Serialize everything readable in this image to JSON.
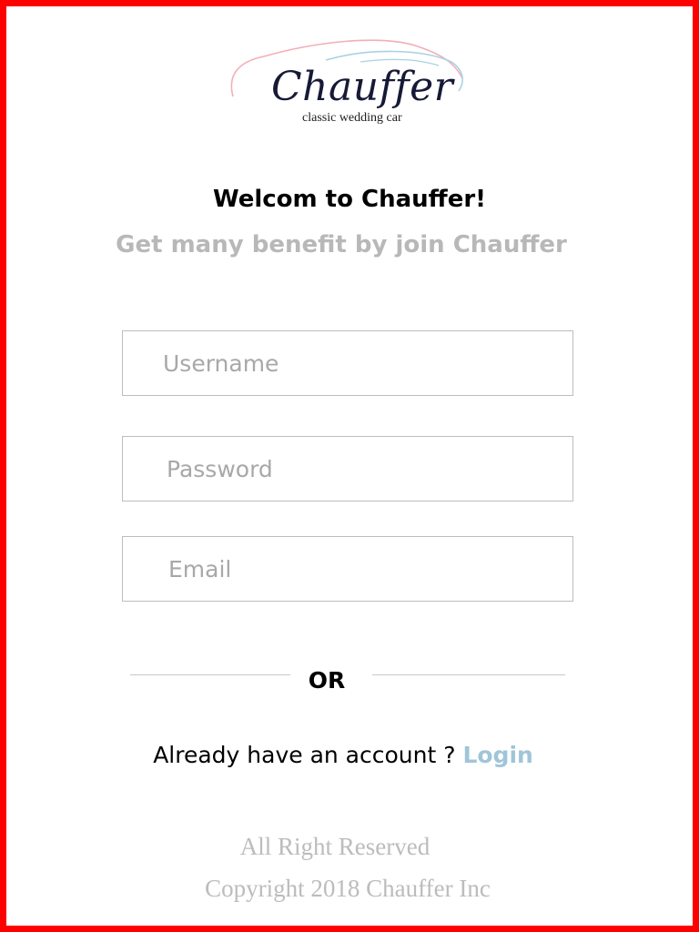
{
  "logo": {
    "wordmark": "Chauffer",
    "tagline": "classic wedding car",
    "colors": {
      "pink": "#f2aeb8",
      "blue": "#a9d2e2",
      "navy": "#161a36"
    }
  },
  "header": {
    "title": "Welcom to Chauffer!",
    "subtitle": "Get many benefit by join Chauffer"
  },
  "form": {
    "username": {
      "placeholder": "Username",
      "value": ""
    },
    "password": {
      "placeholder": "Password",
      "value": ""
    },
    "email": {
      "placeholder": "Email",
      "value": ""
    }
  },
  "divider": {
    "label": "OR"
  },
  "account": {
    "prompt": "Already have an account ? ",
    "login_label": "Login",
    "link_color": "#9fc5d8"
  },
  "footer": {
    "rights": "All Right Reserved",
    "copyright": "Copyright 2018 Chauffer Inc"
  },
  "theme": {
    "frame_color": "#ff0000",
    "placeholder_color": "#a8a8a8",
    "subtitle_color": "#b8b8b8"
  }
}
